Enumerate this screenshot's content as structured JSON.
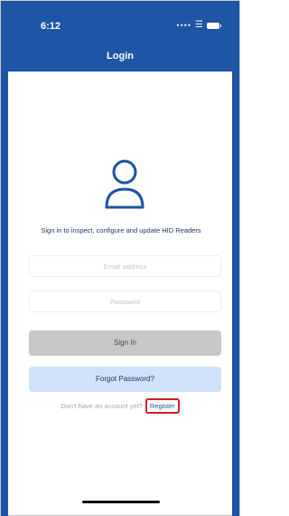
{
  "status_bar": {
    "time": "6:12",
    "icons": [
      "signal-icon",
      "wifi-icon",
      "battery-icon"
    ]
  },
  "header": {
    "title": "Login",
    "background": "#1e55a5"
  },
  "content": {
    "icon": "user-icon",
    "subtitle": "Sign in to inspect, configure and update HID Readers"
  },
  "form": {
    "email": {
      "value": "",
      "placeholder": "Email address"
    },
    "password": {
      "value": "",
      "placeholder": "Password"
    },
    "signin_label": "Sign In",
    "forgot_label": "Forgot Password?"
  },
  "register": {
    "prompt": "Don't have an account yet?",
    "link_label": "Register",
    "highlight_color": "#d0202a"
  },
  "colors": {
    "accent": "#1e55a5",
    "signin_bg": "#c7c7c7",
    "forgot_bg": "#cfe2f7"
  }
}
